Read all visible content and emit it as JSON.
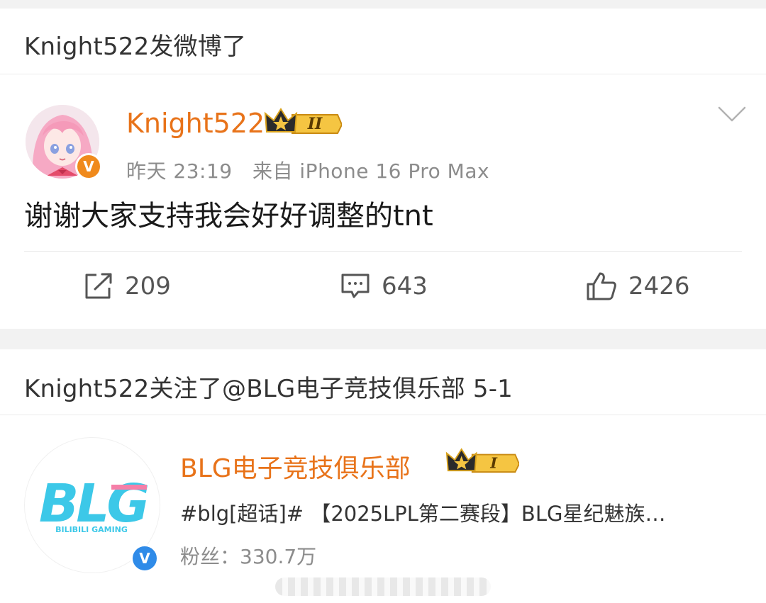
{
  "colors": {
    "accent": "#e8731a",
    "background": "#f2f2f2",
    "verified_orange": "#f08a1c",
    "verified_blue": "#2f8be8",
    "blg_logo_cyan": "#3cc8e8",
    "blg_logo_pink": "#f57fa8"
  },
  "post_section": {
    "header": "Knight522发微博了",
    "user": {
      "name": "Knight522",
      "level_badge": "II",
      "verified_icon": "orange-v-icon"
    },
    "meta": {
      "time": "昨天 23:19",
      "source": "来自 iPhone 16 Pro Max"
    },
    "body": "谢谢大家支持我会好好调整的tnt",
    "actions": {
      "repost_icon": "share-icon",
      "repost_count": "209",
      "comment_icon": "comment-icon",
      "comment_count": "643",
      "like_icon": "thumbs-up-icon",
      "like_count": "2426"
    },
    "menu_icon": "chevron-down-icon"
  },
  "follow_section": {
    "header": "Knight522关注了@BLG电子竞技俱乐部 5-1",
    "account": {
      "name": "BLG电子竞技俱乐部",
      "level_badge": "I",
      "description": "#blg[超话]#  【2025LPL第二赛段】BLG星纪魅族…",
      "fans": "粉丝：330.7万",
      "logo_text": "BLG",
      "logo_subtext": "BILIBILI GAMING",
      "verified_icon": "blue-v-icon"
    }
  }
}
